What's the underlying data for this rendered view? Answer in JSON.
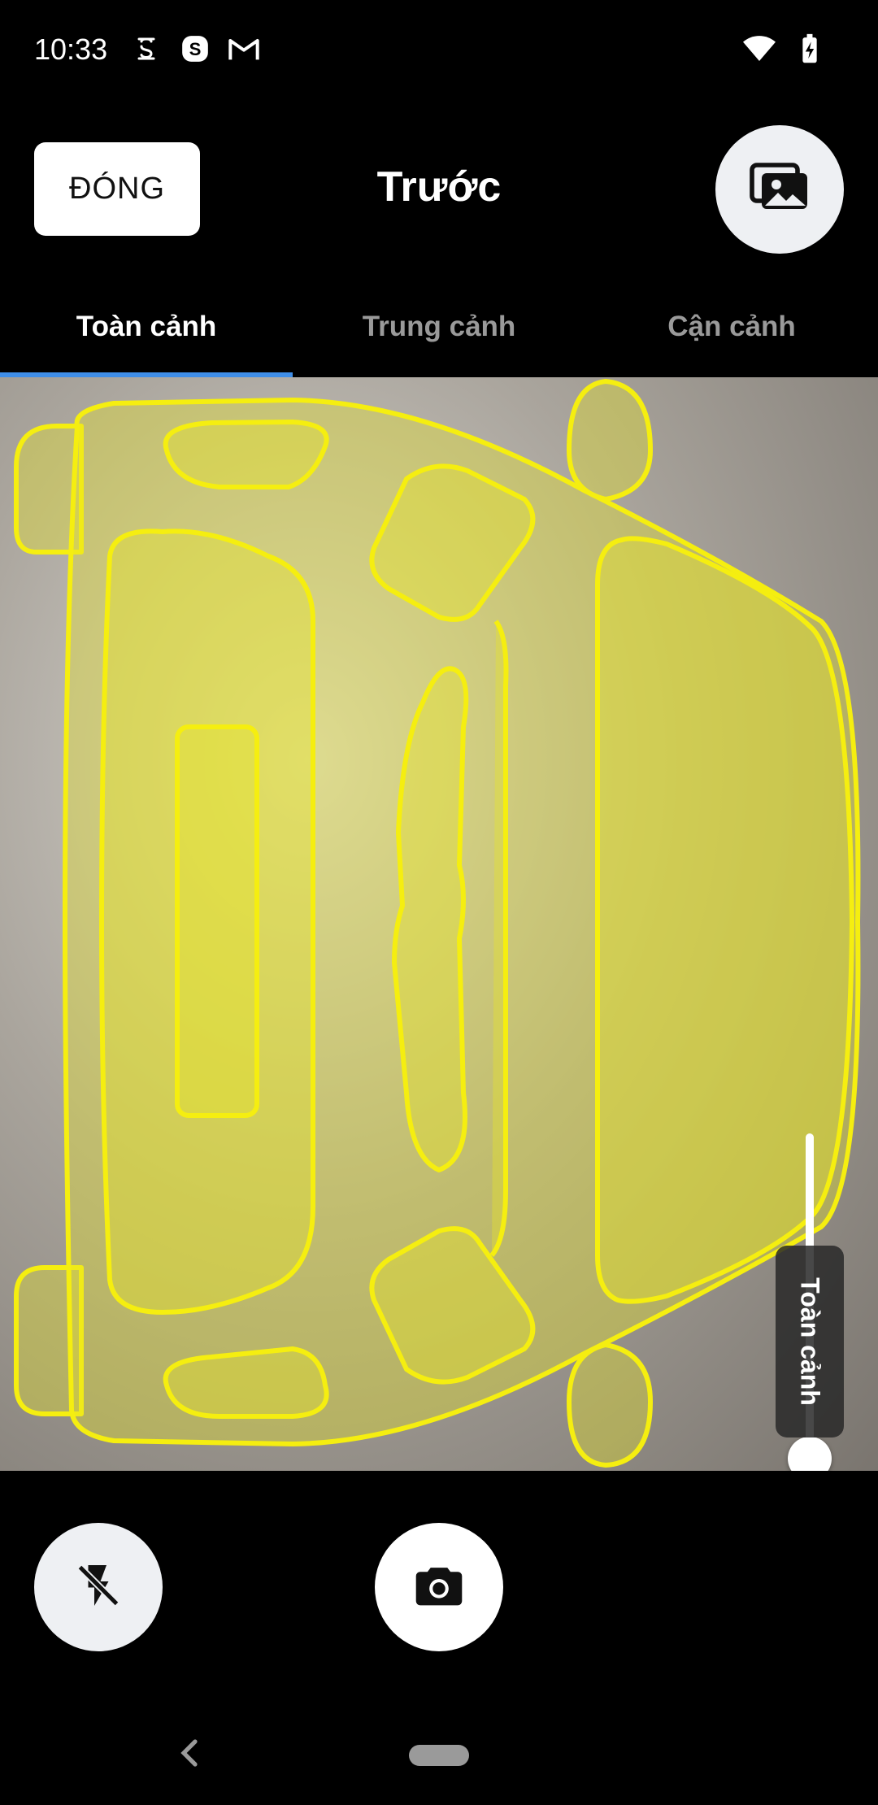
{
  "status_bar": {
    "time": "10:33",
    "left_icons": [
      "lock-s-icon",
      "skype-icon",
      "gmail-icon"
    ],
    "right_icons": [
      "wifi-icon",
      "battery-charging-icon"
    ]
  },
  "header": {
    "close_label": "ĐÓNG",
    "title": "Trước",
    "gallery_icon": "gallery-icon"
  },
  "tabs": [
    {
      "label": "Toàn cảnh",
      "active": true
    },
    {
      "label": "Trung cảnh",
      "active": false
    },
    {
      "label": "Cận cảnh",
      "active": false
    }
  ],
  "viewport": {
    "overlay_color": "#f5ee10",
    "zoom_level": 0.95,
    "view_label": "Toàn cảnh"
  },
  "controls": {
    "flash_icon": "flash-off-icon",
    "shutter_icon": "camera-icon"
  },
  "nav": {
    "back_icon": "back-chevron-icon",
    "home_icon": "home-pill-icon"
  },
  "colors": {
    "tab_indicator": "#3f8ee8",
    "active_tab": "#ffffff",
    "inactive_tab": "#9a9a9a"
  }
}
